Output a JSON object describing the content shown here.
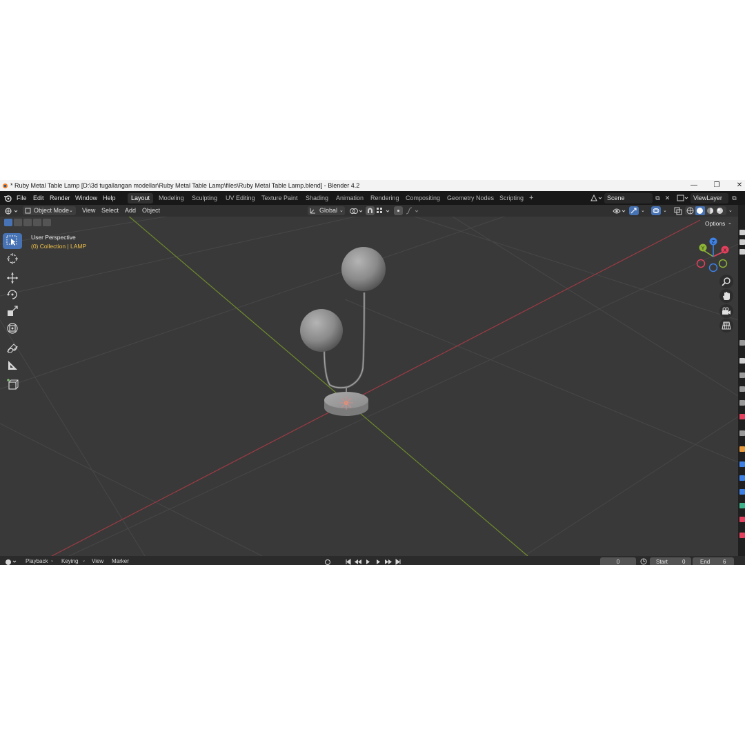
{
  "window": {
    "title": "* Ruby Metal Table Lamp [D:\\3d tugallangan modellar\\Ruby Metal Table Lamp\\files\\Ruby Metal Table Lamp.blend] - Blender 4.2",
    "minimize": "—",
    "maximize": "❐",
    "close": "✕"
  },
  "menu": [
    "File",
    "Edit",
    "Render",
    "Window",
    "Help"
  ],
  "workspaces": [
    "Layout",
    "Modeling",
    "Sculpting",
    "UV Editing",
    "Texture Paint",
    "Shading",
    "Animation",
    "Rendering",
    "Compositing",
    "Geometry Nodes",
    "Scripting"
  ],
  "add_workspace": "+",
  "scene": {
    "name": "Scene"
  },
  "view_layer": {
    "name": "ViewLayer"
  },
  "viewport_header": {
    "mode": "Object Mode",
    "menus": [
      "View",
      "Select",
      "Add",
      "Object"
    ],
    "transform_orientation": "Global"
  },
  "viewport": {
    "perspective": "User Perspective",
    "collection": "(0) Collection | LAMP",
    "options_label": "Options",
    "gizmo": {
      "x": "X",
      "y": "Y",
      "z": "Z"
    }
  },
  "timeline": {
    "menus": [
      "Playback",
      "Keying",
      "View",
      "Marker"
    ],
    "current_frame": "0",
    "start_label": "Start",
    "start_value": "0",
    "end_label": "End",
    "end_value": "6"
  },
  "colors": {
    "accent": "#4772b3",
    "x_axis": "#e5405d",
    "y_axis": "#8cb534",
    "z_axis": "#3d81e6",
    "collection_text": "#f0c24b"
  },
  "icons": [
    "blender-logo-icon",
    "select-box-icon",
    "cursor-icon",
    "move-icon",
    "rotate-icon",
    "scale-icon",
    "transform-icon",
    "annotate-icon",
    "measure-icon",
    "add-cube-icon",
    "zoom-icon",
    "hand-pan-icon",
    "camera-icon",
    "grid-ortho-icon"
  ]
}
